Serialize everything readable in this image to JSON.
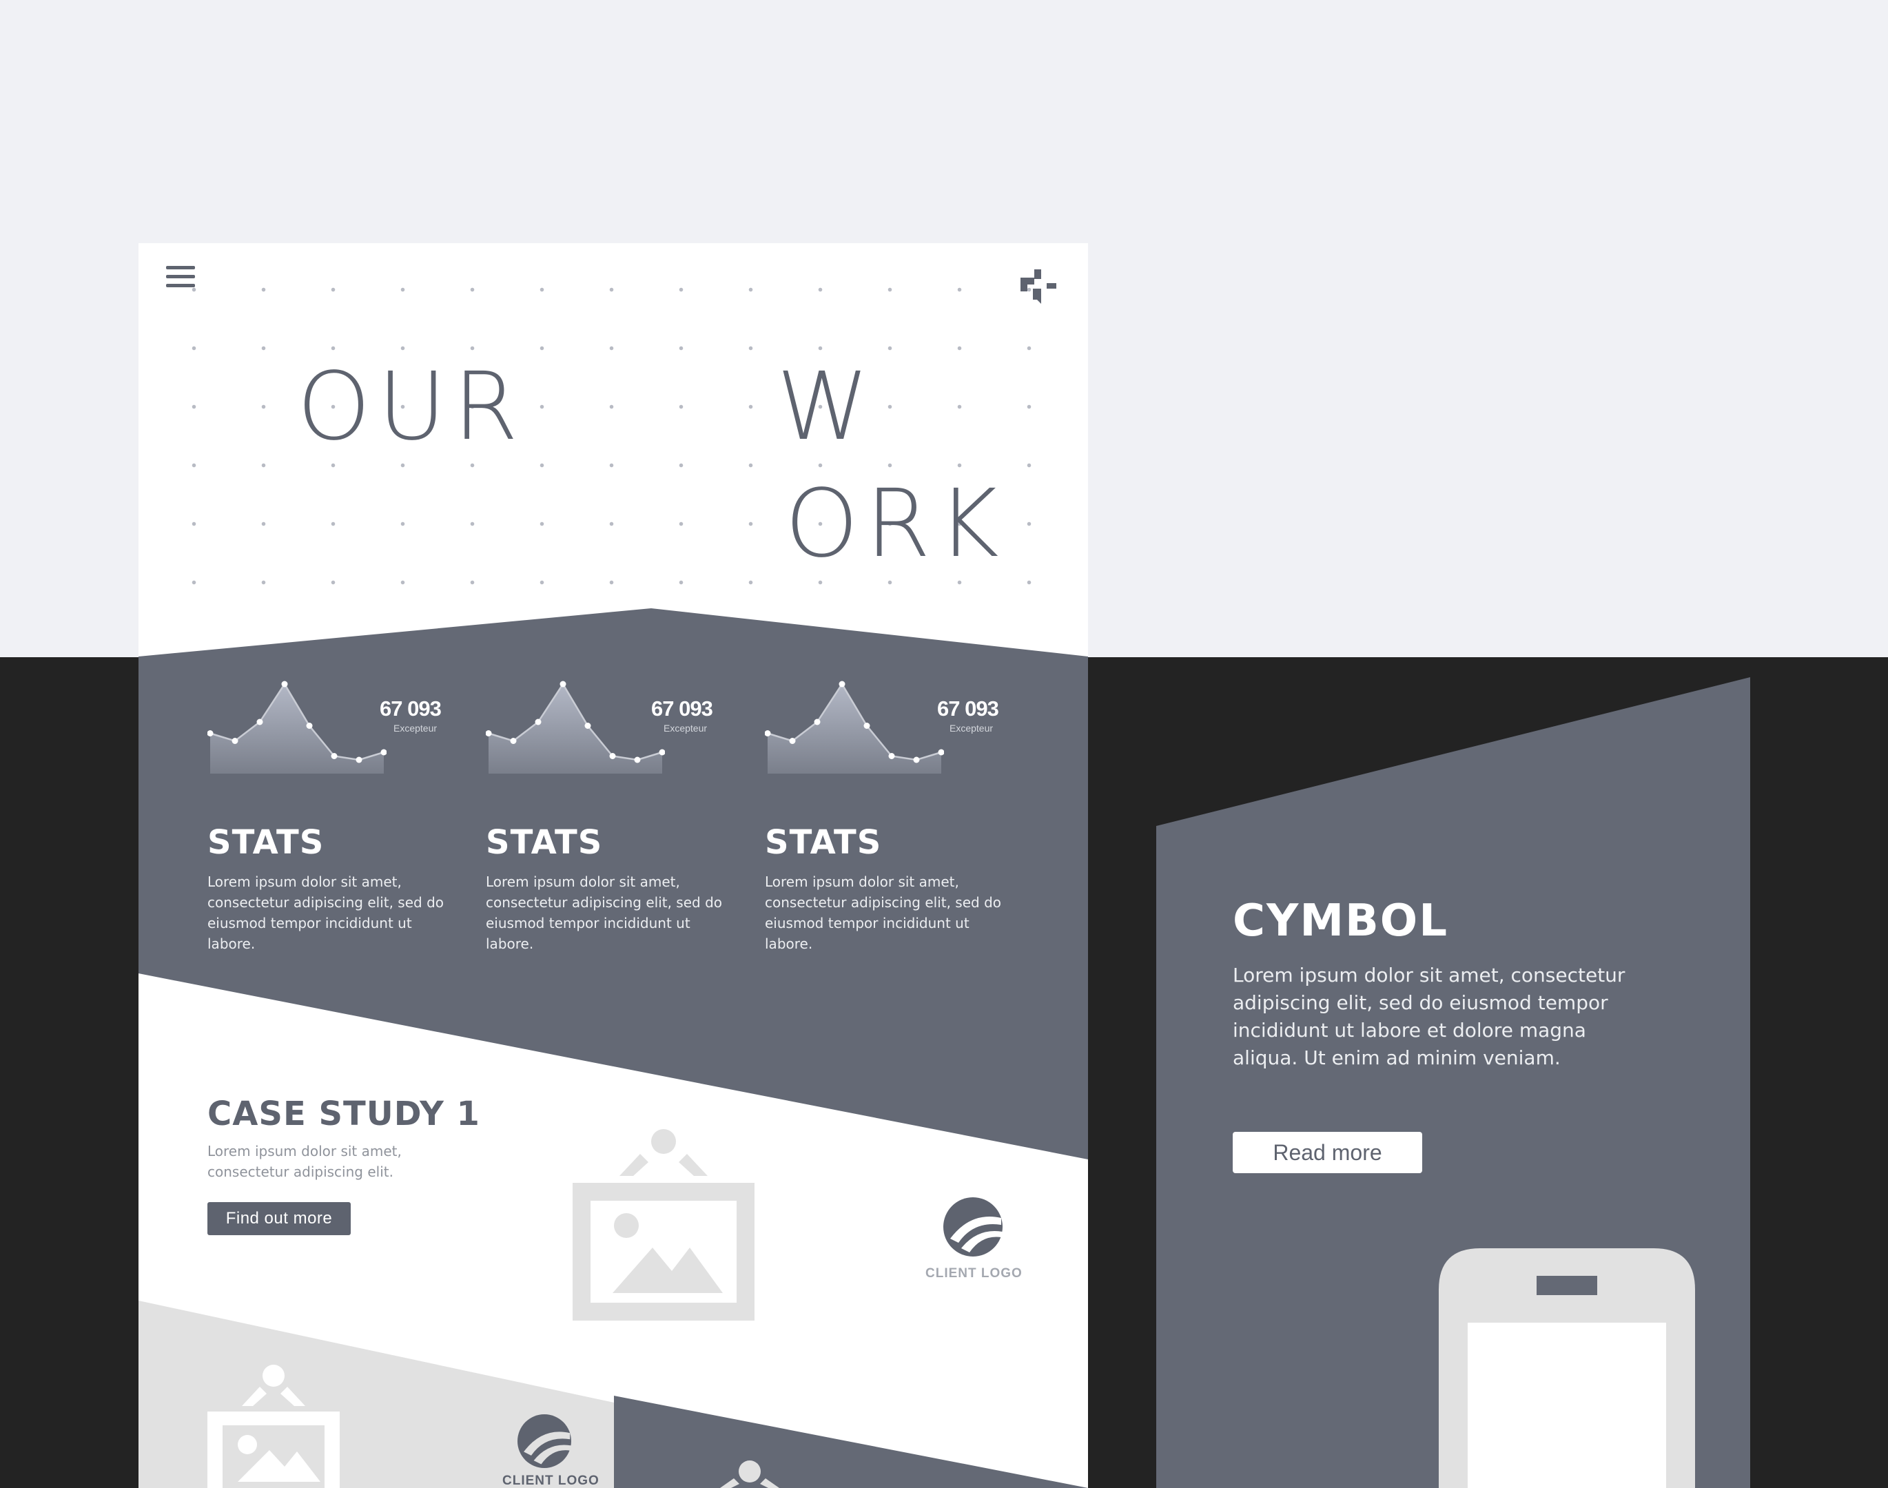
{
  "hero": {
    "word_our": "OUR",
    "word_w": "W",
    "word_ork": "ORK"
  },
  "stats": [
    {
      "number": "67 093",
      "number_caption": "Excepteur",
      "title": "STATS",
      "body": "Lorem ipsum dolor sit amet, consectetur adipiscing elit, sed do eiusmod tempor incididunt ut labore.",
      "sparkline": [
        0.35,
        0.25,
        0.5,
        1.0,
        0.45,
        0.05,
        0.0,
        0.1
      ]
    },
    {
      "number": "67 093",
      "number_caption": "Excepteur",
      "title": "STATS",
      "body": "Lorem ipsum dolor sit amet, consectetur adipiscing elit, sed do eiusmod tempor incididunt ut labore.",
      "sparkline": [
        0.35,
        0.25,
        0.5,
        1.0,
        0.45,
        0.05,
        0.0,
        0.1
      ]
    },
    {
      "number": "67 093",
      "number_caption": "Excepteur",
      "title": "STATS",
      "body": "Lorem ipsum dolor sit amet, consectetur adipiscing elit, sed do eiusmod tempor incididunt ut labore.",
      "sparkline": [
        0.35,
        0.25,
        0.5,
        1.0,
        0.45,
        0.05,
        0.0,
        0.1
      ]
    }
  ],
  "case_study": {
    "title": "CASE STUDY 1",
    "body": "Lorem ipsum dolor sit amet, consectetur adipiscing elit.",
    "button": "Find out more",
    "client_logo": "CLIENT LOGO"
  },
  "lower_section": {
    "client_logo": "CLIENT LOGO"
  },
  "card": {
    "title": "CYMBOL",
    "body": "Lorem ipsum dolor sit amet, consectetur adipiscing elit, sed do eiusmod tempor incididunt ut labore et dolore magna aliqua. Ut enim ad minim veniam.",
    "button": "Read more"
  },
  "icons": {
    "menu": "hamburger-menu-icon",
    "logo": "brand-logo-icon",
    "placeholder": "image-placeholder-icon",
    "client": "client-logo-icon",
    "phone": "phone-mockup-icon"
  },
  "colors": {
    "page_bg": "#f0f1f5",
    "dark_band": "#232323",
    "slate": "#646975",
    "text_dark": "#5e636f",
    "light_gray": "#e1e1e1",
    "white": "#ffffff"
  }
}
